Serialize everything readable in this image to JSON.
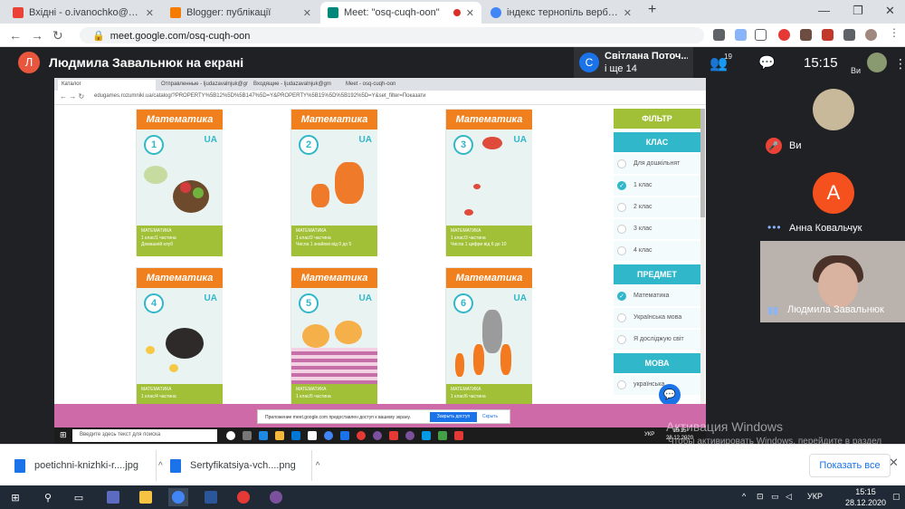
{
  "browser": {
    "tabs": [
      {
        "label": "Вхідні - o.ivanochko@ippo.edu.te",
        "icon": "gmail-icon",
        "color": "#ea4335"
      },
      {
        "label": "Blogger: публікації",
        "icon": "blogger-icon",
        "color": "#f57c00"
      },
      {
        "label": "Meet: \"osq-cuqh-oon\"",
        "icon": "meet-icon",
        "color": "#00897b"
      },
      {
        "label": "індекс тернопіль вербицькаого",
        "icon": "google-icon",
        "color": "#4285f4"
      }
    ],
    "new_tab": "+",
    "url": "meet.google.com/osq-cuqh-oon"
  },
  "meet": {
    "presenter_initial": "Л",
    "presenter_title": "Людмила Завальнюк на екрані",
    "participants_avatar": "С",
    "participants_line1": "Світлана Поточ...",
    "participants_line2": "і ще 14",
    "people_count": "19",
    "time": "15:15",
    "self_label": "Ви",
    "tiles": [
      {
        "name": "Ви",
        "muted": true
      },
      {
        "name": "Анна Ковальчук",
        "initial": "А"
      },
      {
        "name": "Людмила Завальнюк"
      }
    ]
  },
  "shared": {
    "tabs": [
      "Каталог",
      "Отправленные - ljudazavalnjuk@gm",
      "Входящие - ljudazavalnjuk@gm",
      "Meet - osq-cuqh-oon"
    ],
    "url": "edugames.rozumniki.ua/catalog/?PROPERTY%5B12%5D%5B147%5D=Y&PROPERTY%5B15%5D%5B192%5D=Y&set_filter=Показати",
    "cards": [
      {
        "title": "Математика",
        "num": "1",
        "ua": "UA",
        "foot": [
          "МАТЕМАТИКА",
          "1 клас/1 частина",
          "Домашній клуб"
        ]
      },
      {
        "title": "Математика",
        "num": "2",
        "ua": "UA",
        "foot": [
          "МАТЕМАТИКА",
          "1 клас/2 частина",
          "Числа 1 знайомі від 0 до 5"
        ]
      },
      {
        "title": "Математика",
        "num": "3",
        "ua": "UA",
        "foot": [
          "МАТЕМАТИКА",
          "1 клас/3 частина",
          "Числа 1 цифри від 6 до 10"
        ]
      },
      {
        "title": "Математика",
        "num": "4",
        "ua": "UA",
        "foot": [
          "МАТЕМАТИКА",
          "1 клас/4 частина"
        ]
      },
      {
        "title": "Математика",
        "num": "5",
        "ua": "UA",
        "foot": [
          "МАТЕМАТИКА",
          "1 клас/5 частина"
        ]
      },
      {
        "title": "Математика",
        "num": "6",
        "ua": "UA",
        "foot": [
          "МАТЕМАТИКА",
          "1 клас/6 частина"
        ]
      }
    ],
    "filter": {
      "title": "ФІЛЬТР",
      "class_header": "КЛАС",
      "classes": [
        {
          "label": "Для дошкільнят",
          "checked": false
        },
        {
          "label": "1 клас",
          "checked": true
        },
        {
          "label": "2 клас",
          "checked": false
        },
        {
          "label": "3 клас",
          "checked": false
        },
        {
          "label": "4 клас",
          "checked": false
        }
      ],
      "subject_header": "ПРЕДМЕТ",
      "subjects": [
        {
          "label": "Математика",
          "checked": true
        },
        {
          "label": "Українська мова",
          "checked": false
        },
        {
          "label": "Я досліджую світ",
          "checked": false
        }
      ],
      "lang_header": "МОВА",
      "langs": [
        {
          "label": "українська",
          "checked": false
        }
      ]
    },
    "notify_text": "Приложение meet.google.com предоставлен доступ к вашему экрану.",
    "notify_stop": "Закрыть доступ",
    "notify_hide": "Скрыть",
    "taskbar_search": "Введите здесь текст для поиска",
    "taskbar_lang": "УКР",
    "taskbar_time": "15:15",
    "taskbar_date": "28.12.2020"
  },
  "watermark": {
    "line1": "Активация Windows",
    "line2": "Чтобы активировать Windows, перейдите в раздел \"Параметры\"."
  },
  "downloads": {
    "items": [
      "poetichni-knizhki-r....jpg",
      "Sertyfikatsiya-vch....png"
    ],
    "show_all": "Показать все"
  },
  "taskbar": {
    "lang": "УКР",
    "time": "15:15",
    "date": "28.12.2020"
  },
  "colors": {
    "orange": "#f07f1d",
    "teal": "#30b7c9",
    "green": "#a2c037",
    "meet_bg": "#202124"
  }
}
